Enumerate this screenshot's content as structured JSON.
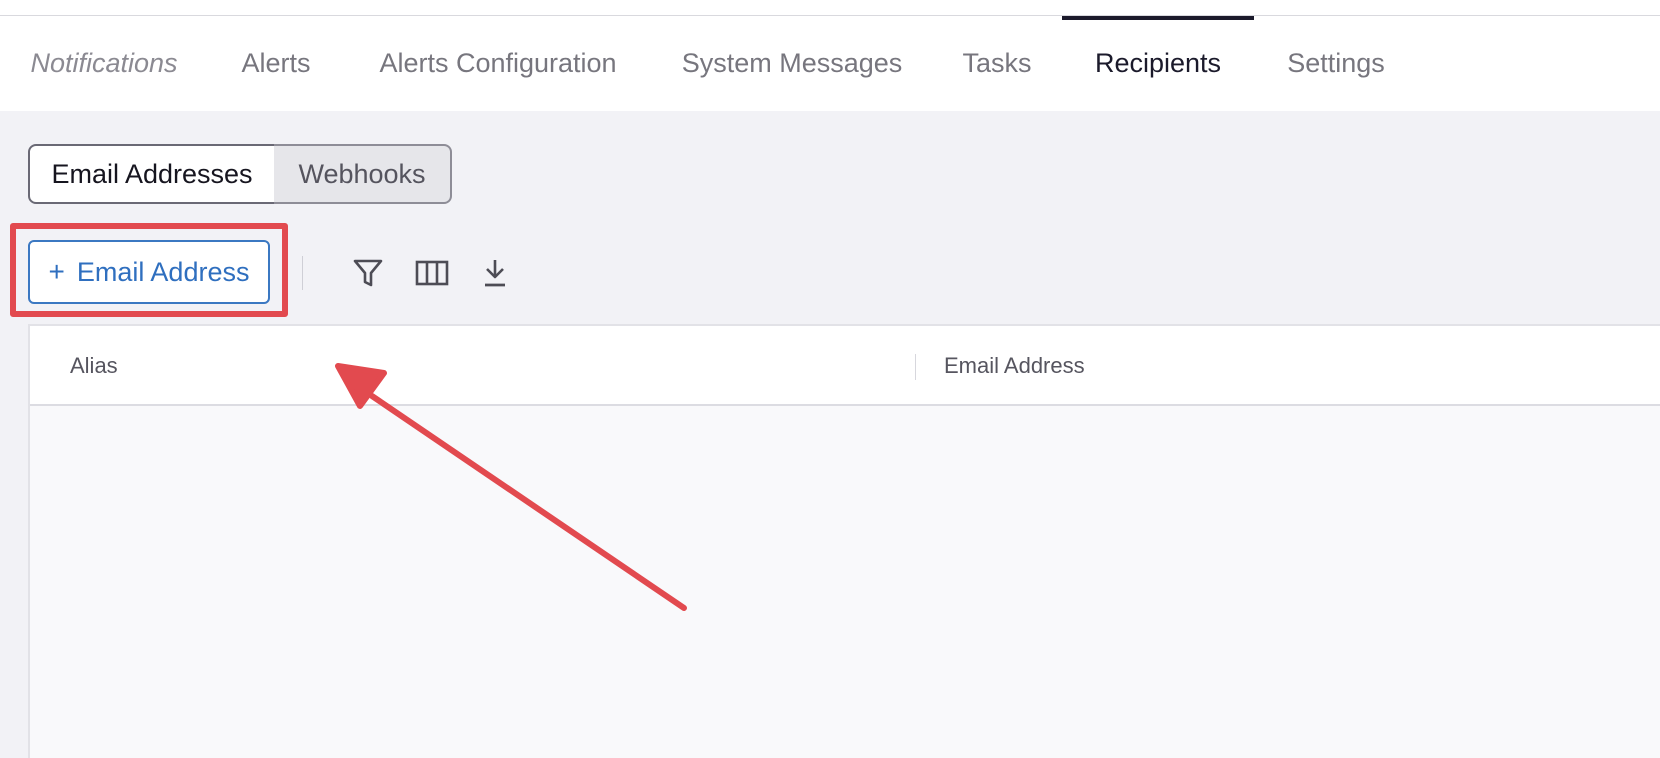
{
  "tabs": {
    "heading": "Notifications",
    "items": [
      "Alerts",
      "Alerts Configuration",
      "System Messages",
      "Tasks",
      "Recipients",
      "Settings"
    ],
    "active": "Recipients"
  },
  "segmented": {
    "email": "Email Addresses",
    "webhooks": "Webhooks",
    "selected": "Email Addresses"
  },
  "toolbar": {
    "add_plus": "+",
    "add_label": "Email Address",
    "icons": [
      "filter-icon",
      "columns-icon",
      "download-icon"
    ]
  },
  "table": {
    "columns": [
      "Alias",
      "Email Address"
    ],
    "rows": []
  },
  "annotation": {
    "color": "#e24a4f"
  },
  "colors": {
    "accent": "#2f6fbf",
    "active_tab": "#1b1a2b",
    "background": "#f2f2f6"
  }
}
